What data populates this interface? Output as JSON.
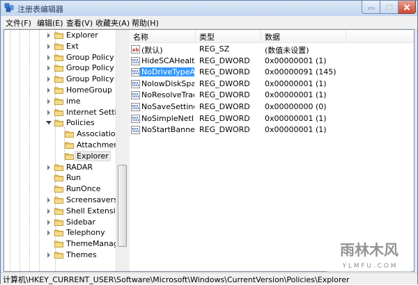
{
  "window": {
    "title": "注册表编辑器"
  },
  "menu": [
    "文件(F)",
    "编辑(E)",
    "查看(V)",
    "收藏夹(A)",
    "帮助(H)"
  ],
  "tree": [
    {
      "label": "Explorer",
      "depth": 1,
      "expander": "closed"
    },
    {
      "label": "Ext",
      "depth": 1,
      "expander": "closed"
    },
    {
      "label": "Group Policy",
      "depth": 1,
      "expander": "closed"
    },
    {
      "label": "Group Policy Ed",
      "depth": 1,
      "expander": "closed"
    },
    {
      "label": "Group Policy O",
      "depth": 1,
      "expander": "closed"
    },
    {
      "label": "HomeGroup",
      "depth": 1,
      "expander": "closed"
    },
    {
      "label": "ime",
      "depth": 1,
      "expander": "closed"
    },
    {
      "label": "Internet Setting",
      "depth": 1,
      "expander": "closed"
    },
    {
      "label": "Policies",
      "depth": 1,
      "expander": "open"
    },
    {
      "label": "Associations",
      "depth": 2,
      "expander": "none"
    },
    {
      "label": "Attachments",
      "depth": 2,
      "expander": "none"
    },
    {
      "label": "Explorer",
      "depth": 2,
      "expander": "none",
      "selected": true
    },
    {
      "label": "RADAR",
      "depth": 1,
      "expander": "closed"
    },
    {
      "label": "Run",
      "depth": 1,
      "expander": "none"
    },
    {
      "label": "RunOnce",
      "depth": 1,
      "expander": "none"
    },
    {
      "label": "Screensavers",
      "depth": 1,
      "expander": "closed"
    },
    {
      "label": "Shell Extensions",
      "depth": 1,
      "expander": "closed"
    },
    {
      "label": "Sidebar",
      "depth": 1,
      "expander": "closed"
    },
    {
      "label": "Telephony",
      "depth": 1,
      "expander": "closed"
    },
    {
      "label": "ThemeManage",
      "depth": 1,
      "expander": "none"
    },
    {
      "label": "Themes",
      "depth": 1,
      "expander": "closed"
    }
  ],
  "columns": {
    "name": "名称",
    "type": "类型",
    "data": "数据"
  },
  "values": [
    {
      "name": "(默认)",
      "type": "REG_SZ",
      "data": "(数值未设置)",
      "icon": "string-value-icon"
    },
    {
      "name": "HideSCAHealth",
      "type": "REG_DWORD",
      "data": "0x00000001 (1)",
      "icon": "dword-value-icon"
    },
    {
      "name": "NoDriveTypeA...",
      "type": "REG_DWORD",
      "data": "0x00000091 (145)",
      "icon": "dword-value-icon",
      "selected": true
    },
    {
      "name": "NolowDiskSpa...",
      "type": "REG_DWORD",
      "data": "0x00000001 (1)",
      "icon": "dword-value-icon"
    },
    {
      "name": "NoResolveTrack",
      "type": "REG_DWORD",
      "data": "0x00000001 (1)",
      "icon": "dword-value-icon"
    },
    {
      "name": "NoSaveSettings",
      "type": "REG_DWORD",
      "data": "0x00000000 (0)",
      "icon": "dword-value-icon"
    },
    {
      "name": "NoSimpleNetI...",
      "type": "REG_DWORD",
      "data": "0x00000001 (1)",
      "icon": "dword-value-icon"
    },
    {
      "name": "NoStartBanner",
      "type": "REG_DWORD",
      "data": "0x00000001 (1)",
      "icon": "dword-value-icon"
    }
  ],
  "status": "计算机\\HKEY_CURRENT_USER\\Software\\Microsoft\\Windows\\CurrentVersion\\Policies\\Explorer",
  "watermark": {
    "brand": "雨林木风",
    "url": "Y L M F U . C O M"
  },
  "colors": {
    "selection": "#3399ff",
    "folder": "#e8c25a"
  }
}
